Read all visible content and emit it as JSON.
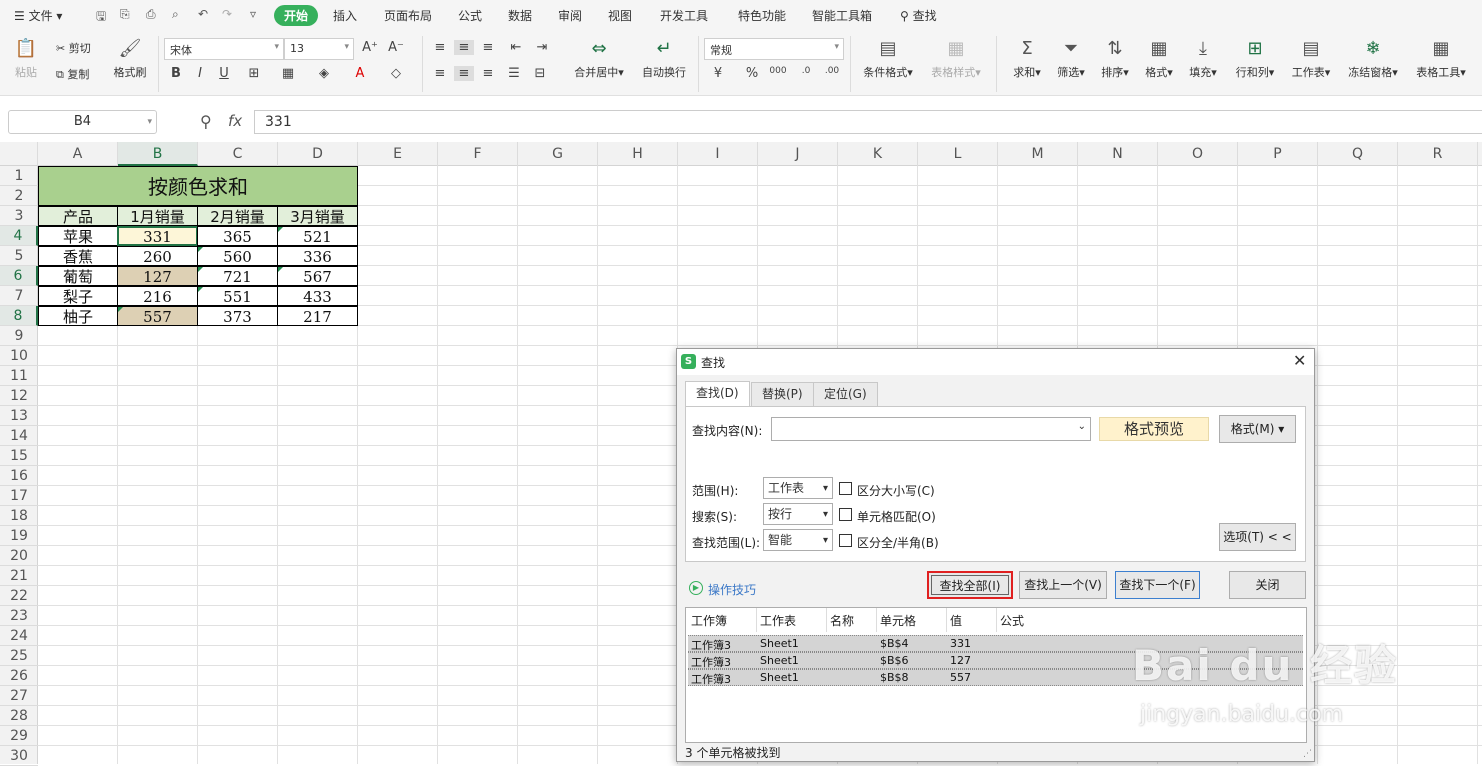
{
  "menu": {
    "file": "文件",
    "tabs": [
      "开始",
      "插入",
      "页面布局",
      "公式",
      "数据",
      "审阅",
      "视图",
      "开发工具",
      "特色功能",
      "智能工具箱"
    ],
    "search": "查找"
  },
  "ribbon": {
    "paste": "粘贴",
    "cut": "剪切",
    "copy": "复制",
    "format_painter": "格式刷",
    "font": "宋体",
    "size": "13",
    "number_format": "常规",
    "merge": "合并居中",
    "wrap": "自动换行",
    "cond": "条件格式",
    "table_style": "表格样式",
    "sum": "求和",
    "filter": "筛选",
    "sort": "排序",
    "format": "格式",
    "fill": "填充",
    "rowcol": "行和列",
    "sheet": "工作表",
    "freeze": "冻结窗格",
    "table_tools": "表格工具"
  },
  "formula_bar": {
    "cell_ref": "B4",
    "fx": "fx",
    "value": "331"
  },
  "columns": [
    "A",
    "B",
    "C",
    "D",
    "E",
    "F",
    "G",
    "H",
    "I",
    "J",
    "K",
    "L",
    "M",
    "N",
    "O",
    "P",
    "Q",
    "R"
  ],
  "rows": [
    "1",
    "2",
    "3",
    "4",
    "5",
    "6",
    "7",
    "8",
    "9",
    "10",
    "11",
    "12",
    "13",
    "14",
    "15",
    "16",
    "17",
    "18",
    "19",
    "20",
    "21",
    "22",
    "23",
    "24",
    "25",
    "26",
    "27",
    "28",
    "29",
    "30"
  ],
  "sheet": {
    "title": "按颜色求和",
    "headers": [
      "产品",
      "1月销量",
      "2月销量",
      "3月销量"
    ],
    "data": [
      [
        "苹果",
        "331",
        "365",
        "521"
      ],
      [
        "香蕉",
        "260",
        "560",
        "336"
      ],
      [
        "葡萄",
        "127",
        "721",
        "567"
      ],
      [
        "梨子",
        "216",
        "551",
        "433"
      ],
      [
        "柚子",
        "557",
        "373",
        "217"
      ]
    ]
  },
  "dialog": {
    "title": "查找",
    "tabs": [
      "查找(D)",
      "替换(P)",
      "定位(G)"
    ],
    "find_label": "查找内容(N):",
    "find_value": "",
    "format_preview": "格式预览",
    "format_btn": "格式(M)",
    "scope_label": "范围(H):",
    "scope_value": "工作表",
    "search_label": "搜索(S):",
    "search_value": "按行",
    "lookin_label": "查找范围(L):",
    "lookin_value": "智能",
    "match_case": "区分大小写(C)",
    "match_cell": "单元格匹配(O)",
    "match_width": "区分全/半角(B)",
    "options_btn": "选项(T) < <",
    "tips": "操作技巧",
    "find_all": "查找全部(I)",
    "find_prev": "查找上一个(V)",
    "find_next": "查找下一个(F)",
    "close": "关闭",
    "result_headers": [
      "工作簿",
      "工作表",
      "名称",
      "单元格",
      "值",
      "公式"
    ],
    "results": [
      [
        "工作簿3",
        "Sheet1",
        "",
        "$B$4",
        "331",
        ""
      ],
      [
        "工作簿3",
        "Sheet1",
        "",
        "$B$6",
        "127",
        ""
      ],
      [
        "工作簿3",
        "Sheet1",
        "",
        "$B$8",
        "557",
        ""
      ]
    ],
    "status": "3 个单元格被找到"
  },
  "watermark": {
    "brand": "Bai du 经验",
    "url": "jingyan.baidu.com"
  },
  "colors": {
    "accent": "#36b05c",
    "highlight": "#ddd0b4",
    "title_bg": "#a9d08e",
    "header_bg": "#e2efda"
  }
}
